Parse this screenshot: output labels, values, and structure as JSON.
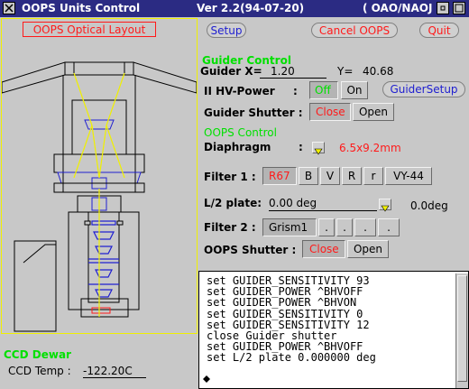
{
  "window": {
    "title": "OOPS Units Control",
    "version": "Ver 2.2(94-07-20)",
    "org": "( OAO/NAOJ )"
  },
  "layout_panel": {
    "title": "OOPS Optical Layout"
  },
  "ccd": {
    "heading": "CCD Dewar",
    "temp_label": "CCD Temp :",
    "temp_value": "-122.20C"
  },
  "buttons": {
    "setup": "Setup",
    "cancel": "Cancel OOPS",
    "quit": "Quit"
  },
  "guider": {
    "heading": "Guider Control",
    "x_label": "Guider X=",
    "x_value": "1.20",
    "y_label": "Y=",
    "y_value": "40.68",
    "hv_label": "II HV-Power",
    "hv_colon": ":",
    "hv_off": "Off",
    "hv_on": "On",
    "setup_button": "GuiderSetup",
    "shutter_label": "Guider Shutter :",
    "shutter_close": "Close",
    "shutter_open": "Open"
  },
  "oops": {
    "heading": "OOPS Control",
    "diaphragm_label": "Diaphragm",
    "diaphragm_colon": ":",
    "diaphragm_value": "6.5x9.2mm",
    "filter1_label": "Filter 1 :",
    "filter1_options": [
      "R67",
      "B",
      "V",
      "R",
      "r",
      "VY-44"
    ],
    "half_plate_label": "L/2 plate:",
    "half_plate_value": "0.00 deg",
    "half_plate_readout": "0.0deg",
    "filter2_label": "Filter 2 :",
    "filter2_options": [
      "Grism1",
      ".",
      ".",
      ".",
      "."
    ],
    "shutter_label": "OOPS Shutter :",
    "shutter_close": "Close",
    "shutter_open": "Open"
  },
  "log": {
    "lines": [
      "set GUIDER_SENSITIVITY 93",
      "set GUIDER_POWER ^BHVOFF",
      "set GUIDER_POWER ^BHVON",
      "set GUIDER_SENSITIVITY 0",
      "set GUIDER_SENSITIVITY 12",
      "close Guider shutter",
      "set GUIDER_POWER ^BHVOFF",
      "set L/2 plate 0.000000 deg"
    ]
  },
  "colors": {
    "titlebar": "#2b2b83",
    "heading_green": "#00e000",
    "active_red": "#ff1a1a",
    "optics_yellow": "#f0f000",
    "optics_blue": "#2020d0"
  }
}
